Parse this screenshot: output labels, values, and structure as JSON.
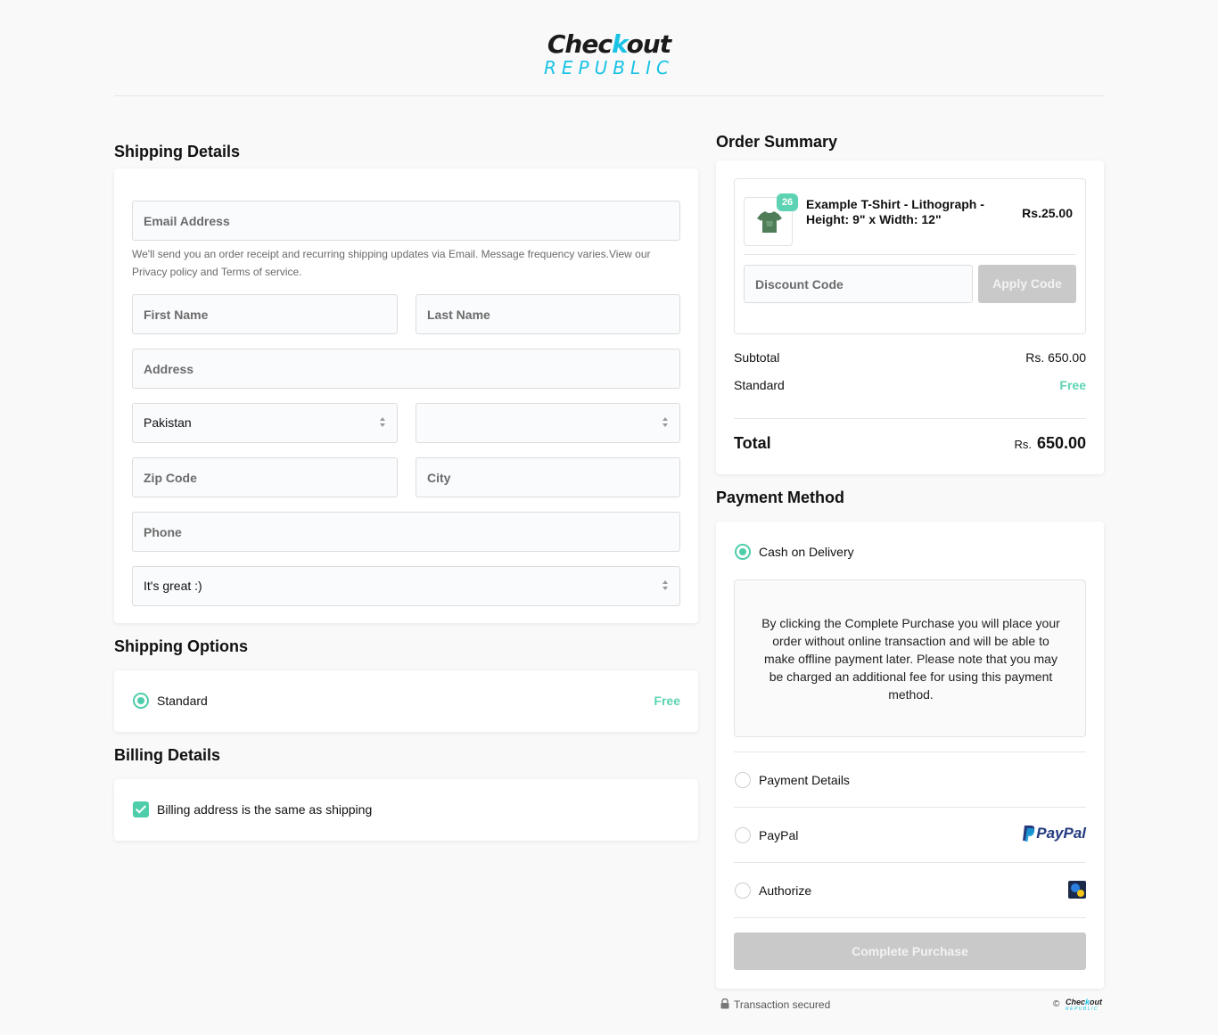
{
  "brand": {
    "logo_top_a": "Chec",
    "logo_top_b": "k",
    "logo_top_c": "out",
    "logo_bottom": "REPUBLIC",
    "accent_color": "#19c3e6",
    "success_color": "#5dd3b3"
  },
  "shipping_details": {
    "title": "Shipping Details",
    "email_placeholder": "Email Address",
    "note": "We'll send you an order receipt and recurring shipping updates via Email. Message frequency varies.View our Privacy policy and Terms of service.",
    "first_name_placeholder": "First Name",
    "last_name_placeholder": "Last Name",
    "address_placeholder": "Address",
    "country_value": "Pakistan",
    "state_value": "",
    "zip_placeholder": "Zip Code",
    "city_placeholder": "City",
    "phone_placeholder": "Phone",
    "feedback_value": "It's great :)"
  },
  "shipping_options": {
    "title": "Shipping Options",
    "option_label": "Standard",
    "option_price": "Free"
  },
  "billing_details": {
    "title": "Billing Details",
    "same_as_shipping_label": "Billing address is the same as shipping",
    "same_as_shipping_checked": true
  },
  "order_summary": {
    "title": "Order Summary",
    "item_name": "Example T-Shirt - Lithograph - Height: 9\" x Width: 12\"",
    "item_qty": "26",
    "item_price": "Rs.25.00",
    "discount_placeholder": "Discount Code",
    "apply_label": "Apply Code",
    "subtotal_label": "Subtotal",
    "subtotal_value": "Rs. 650.00",
    "shipping_label": "Standard",
    "shipping_value": "Free",
    "total_label": "Total",
    "total_currency": "Rs.",
    "total_value": "650.00"
  },
  "payment_method": {
    "title": "Payment Method",
    "cod_label": "Cash on Delivery",
    "cod_note": "By clicking the Complete Purchase you will place your order without online transaction and will be able to make offline payment later. Please note that you may be charged an additional fee for using this payment method.",
    "payment_details_label": "Payment Details",
    "paypal_label": "PayPal",
    "paypal_logo_text": "PayPal",
    "authorize_label": "Authorize",
    "complete_label": "Complete Purchase"
  },
  "footer": {
    "secured_text": "Transaction secured",
    "copyright_symbol": "©",
    "mini_logo_a": "Chec",
    "mini_logo_b": "k",
    "mini_logo_c": "out",
    "mini_logo_bottom": "REPUBLIC"
  },
  "icons": [
    "lock-icon",
    "tshirt-icon",
    "paypal-icon",
    "authorize-icon",
    "select-arrows-icon"
  ]
}
